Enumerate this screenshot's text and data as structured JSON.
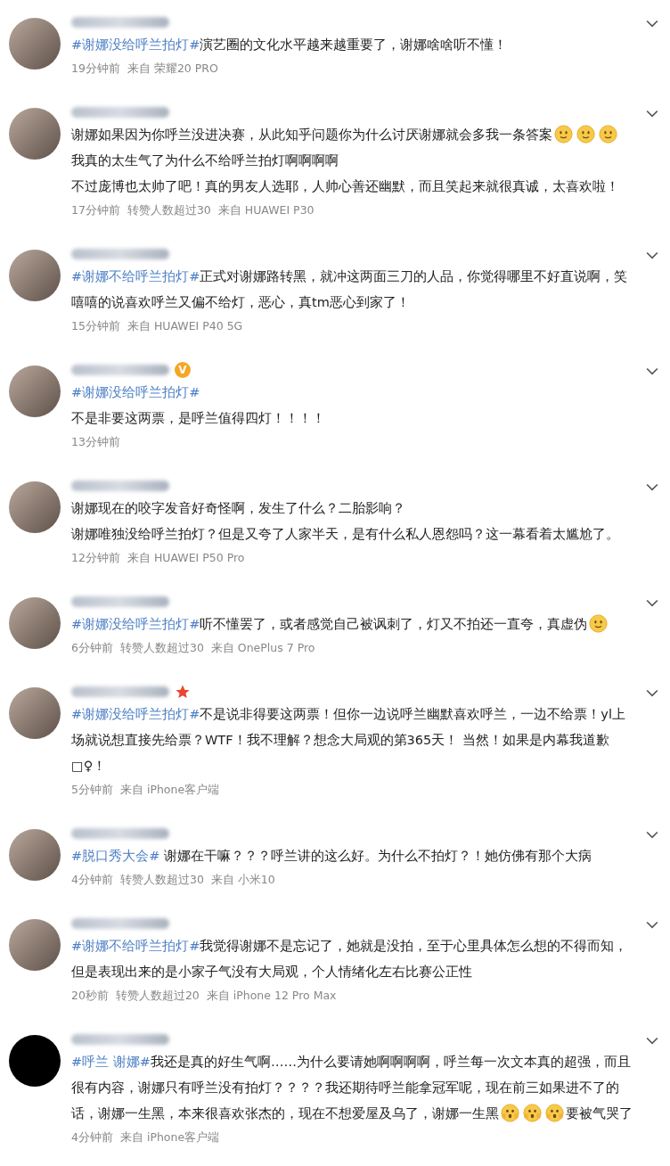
{
  "comments": [
    {
      "avatar": {
        "kind": "photo"
      },
      "paragraphs": [
        [
          {
            "kind": "tag",
            "text": "#谢娜没给呼兰拍灯#"
          },
          {
            "kind": "text",
            "text": "演艺圈的文化水平越来越重要了，谢娜啥啥听不懂！"
          }
        ]
      ],
      "meta": {
        "time": "19分钟前",
        "source": "来自 荣耀20 PRO"
      }
    },
    {
      "avatar": {
        "kind": "photo"
      },
      "paragraphs": [
        [
          {
            "kind": "text",
            "text": "谢娜如果因为你呼兰没进决赛，从此知乎问题你为什么讨厌谢娜就会多我一条答案"
          },
          {
            "kind": "smile"
          },
          {
            "kind": "smile"
          },
          {
            "kind": "smile"
          }
        ],
        [
          {
            "kind": "text",
            "text": "我真的太生气了为什么不给呼兰拍灯啊啊啊啊"
          }
        ],
        [
          {
            "kind": "text",
            "text": "不过庞博也太帅了吧！真的男友人选耶，人帅心善还幽默，而且笑起来就很真诚，太喜欢啦！"
          }
        ]
      ],
      "meta": {
        "time": "17分钟前",
        "likes": "转赞人数超过30",
        "source": "来自 HUAWEI P30"
      }
    },
    {
      "avatar": {
        "kind": "photo"
      },
      "paragraphs": [
        [
          {
            "kind": "tag",
            "text": "#谢娜不给呼兰拍灯#"
          },
          {
            "kind": "text",
            "text": "正式对谢娜路转黑，就冲这两面三刀的人品，你觉得哪里不好直说啊，笑嘻嘻的说喜欢呼兰又偏不给灯，恶心，真tm恶心到家了！"
          }
        ]
      ],
      "meta": {
        "time": "15分钟前",
        "source": "来自 HUAWEI P40 5G"
      }
    },
    {
      "avatar": {
        "kind": "photo"
      },
      "badge": {
        "kind": "verified",
        "text": "V"
      },
      "paragraphs": [
        [
          {
            "kind": "tag",
            "text": "#谢娜没给呼兰拍灯#"
          }
        ],
        [
          {
            "kind": "text",
            "text": "不是非要这两票，是呼兰值得四灯！！！！"
          }
        ]
      ],
      "meta": {
        "time": "13分钟前"
      }
    },
    {
      "avatar": {
        "kind": "photo"
      },
      "paragraphs": [
        [
          {
            "kind": "text",
            "text": "谢娜现在的咬字发音好奇怪啊，发生了什么？二胎影响？"
          }
        ],
        [
          {
            "kind": "text",
            "text": "谢娜唯独没给呼兰拍灯？但是又夸了人家半天，是有什么私人恩怨吗？这一幕看着太尴尬了。"
          }
        ]
      ],
      "meta": {
        "time": "12分钟前",
        "source": "来自 HUAWEI P50 Pro"
      }
    },
    {
      "avatar": {
        "kind": "photo"
      },
      "paragraphs": [
        [
          {
            "kind": "tag",
            "text": "#谢娜没给呼兰拍灯#"
          },
          {
            "kind": "text",
            "text": "听不懂罢了，或者感觉自己被讽刺了，灯又不拍还一直夸，真虚伪"
          },
          {
            "kind": "smile"
          }
        ]
      ],
      "meta": {
        "time": "6分钟前",
        "likes": "转赞人数超过30",
        "source": "来自 OnePlus 7 Pro"
      }
    },
    {
      "avatar": {
        "kind": "photo"
      },
      "badge": {
        "kind": "star"
      },
      "paragraphs": [
        [
          {
            "kind": "tag",
            "text": "#谢娜没给呼兰拍灯#"
          },
          {
            "kind": "text",
            "text": "不是说非得要这两票！但你一边说呼兰幽默喜欢呼兰，一边不给票！yl上场就说想直接先给票？WTF！我不理解？想念大局观的第365天！ 当然！如果是内幕我道歉□♀！"
          }
        ]
      ],
      "meta": {
        "time": "5分钟前",
        "source": "来自 iPhone客户端"
      }
    },
    {
      "avatar": {
        "kind": "photo"
      },
      "paragraphs": [
        [
          {
            "kind": "tag",
            "text": "#脱口秀大会#"
          },
          {
            "kind": "text",
            "text": " 谢娜在干嘛？？？呼兰讲的这么好。为什么不拍灯？！她仿佛有那个大病"
          }
        ]
      ],
      "meta": {
        "time": "4分钟前",
        "likes": "转赞人数超过30",
        "source": "来自 小米10"
      }
    },
    {
      "avatar": {
        "kind": "photo"
      },
      "paragraphs": [
        [
          {
            "kind": "tag",
            "text": "#谢娜不给呼兰拍灯#"
          },
          {
            "kind": "text",
            "text": "我觉得谢娜不是忘记了，她就是没拍，至于心里具体怎么想的不得而知，但是表现出来的是小家子气没有大局观，个人情绪化左右比赛公正性"
          }
        ]
      ],
      "meta": {
        "time": "20秒前",
        "likes": "转赞人数超过20",
        "source": "来自 iPhone 12 Pro Max"
      }
    },
    {
      "avatar": {
        "kind": "black"
      },
      "paragraphs": [
        [
          {
            "kind": "tag",
            "text": "#呼兰 谢娜#"
          },
          {
            "kind": "text",
            "text": "我还是真的好生气啊……为什么要请她啊啊啊啊，呼兰每一次文本真的超强，而且很有内容，谢娜只有呼兰没有拍灯？？？？我还期待呼兰能拿冠军呢，现在前三如果进不了的话，谢娜一生黑，本来很喜欢张杰的，现在不想爱屋及乌了，谢娜一生黑"
          },
          {
            "kind": "scream"
          },
          {
            "kind": "scream"
          },
          {
            "kind": "scream"
          },
          {
            "kind": "text",
            "text": "要被气哭了"
          }
        ]
      ],
      "meta": {
        "time": "4分钟前",
        "source": "来自 iPhone客户端"
      }
    }
  ]
}
